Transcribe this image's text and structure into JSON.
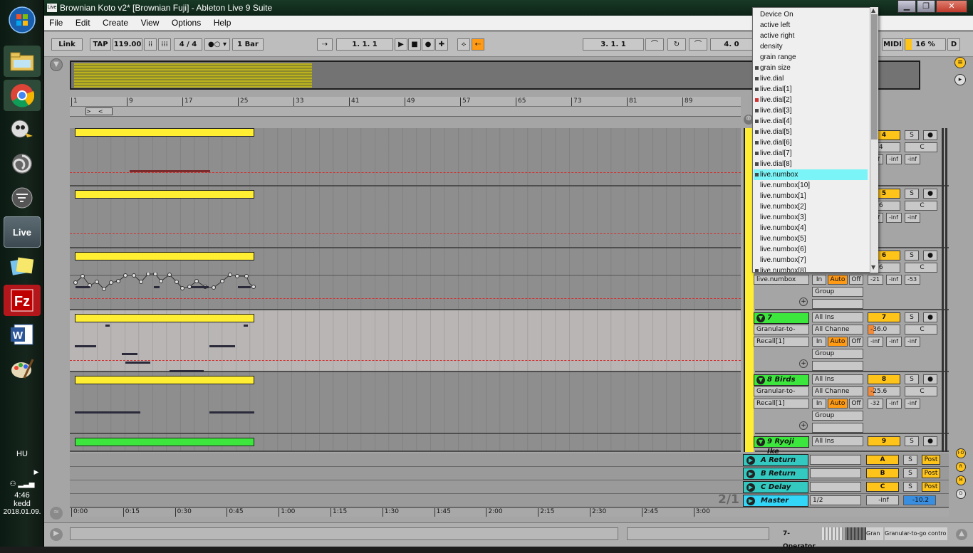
{
  "taskbar": {
    "items": [
      "start-orb",
      "file-explorer",
      "chrome",
      "pidgin",
      "app-spiral",
      "app-wave",
      "ableton-live",
      "sticky-notes",
      "filezilla",
      "word",
      "paint"
    ],
    "live_label": "Live",
    "lang": "HU",
    "time": "4:46",
    "day": "kedd",
    "date": "2018.01.09."
  },
  "window": {
    "title": "Brownian Koto v2*  [Brownian Fuji] - Ableton Live 9 Suite",
    "icon_label": "Live"
  },
  "menu": [
    "File",
    "Edit",
    "Create",
    "View",
    "Options",
    "Help"
  ],
  "control": {
    "link": "Link",
    "tap": "TAP",
    "tempo": "119.00",
    "signature": "4 / 4",
    "quantize": "1 Bar",
    "position": "1.   1.   1",
    "loop_start": "3.   1.   1",
    "loop_length": "4.   0",
    "midi": "MIDI",
    "cpu": "16 %",
    "d": "D"
  },
  "ruler": [
    "1",
    "9",
    "17",
    "25",
    "33",
    "41",
    "49",
    "57",
    "65",
    "73",
    "81",
    "89"
  ],
  "tracks": [
    {
      "name": "",
      "number": "4",
      "vol": "-6.4",
      "pan": "C",
      "l": "-inf",
      "r": "-inf"
    },
    {
      "name": "",
      "number": "5",
      "vol": "-3.6",
      "pan": "C",
      "l": "-inf",
      "r": "-inf"
    },
    {
      "name": "",
      "number": "6",
      "vol": "-9.6",
      "pan": "C",
      "l": "-21",
      "r": "-inf",
      "r2": "-53",
      "param": "live.numbox",
      "in": "In",
      "auto": "Auto",
      "off": "Off",
      "group": "Group"
    },
    {
      "name": "7 Operator",
      "number": "7",
      "input": "All Ins",
      "device": "Granular-to-",
      "channel": "All Channe",
      "vol": "-36.0",
      "pan": "C",
      "recall": "Recall[1]",
      "in": "In",
      "auto": "Auto",
      "off": "Off",
      "l": "-inf",
      "m": "-inf",
      "r": "-inf",
      "group": "Group"
    },
    {
      "name": "8 Birds",
      "number": "8",
      "input": "All Ins",
      "device": "Granular-to-",
      "channel": "All Channe",
      "vol": "-25.6",
      "pan": "C",
      "recall": "Recall[1]",
      "in": "In",
      "auto": "Auto",
      "off": "Off",
      "l": "-32",
      "m": "-inf",
      "r": "-inf",
      "group": "Group"
    },
    {
      "name": "9 Ryoji Ike",
      "number": "9",
      "input": "All Ins"
    }
  ],
  "returns": [
    {
      "name": "A Return",
      "letter": "A",
      "s": "S",
      "post": "Post"
    },
    {
      "name": "B Return",
      "letter": "B",
      "s": "S",
      "post": "Post"
    },
    {
      "name": "C Delay",
      "letter": "C",
      "s": "S",
      "post": "Post"
    },
    {
      "name": "Master",
      "letter": "1/2",
      "vol": "-inf",
      "pan": "-10.2"
    }
  ],
  "timeline": [
    "0:00",
    "0:15",
    "0:30",
    "0:45",
    "1:00",
    "1:15",
    "1:30",
    "1:45",
    "2:00",
    "2:15",
    "2:30",
    "2:45",
    "3:00"
  ],
  "overview_zoom": "2/1",
  "side_buttons": [
    "I·O",
    "R",
    "M",
    "D"
  ],
  "status": {
    "device": "7-Operator",
    "g1": "Gran",
    "g2": "Granular-to-go contro"
  },
  "dropdown": {
    "items": [
      {
        "label": "Device On",
        "sq": "none"
      },
      {
        "label": "active left",
        "sq": "none"
      },
      {
        "label": "active right",
        "sq": "none"
      },
      {
        "label": "density",
        "sq": "none"
      },
      {
        "label": "grain range",
        "sq": "none"
      },
      {
        "label": "grain size",
        "sq": "grey"
      },
      {
        "label": "live.dial",
        "sq": "grey"
      },
      {
        "label": "live.dial[1]",
        "sq": "grey"
      },
      {
        "label": "live.dial[2]",
        "sq": "red"
      },
      {
        "label": "live.dial[3]",
        "sq": "grey"
      },
      {
        "label": "live.dial[4]",
        "sq": "grey"
      },
      {
        "label": "live.dial[5]",
        "sq": "grey"
      },
      {
        "label": "live.dial[6]",
        "sq": "grey"
      },
      {
        "label": "live.dial[7]",
        "sq": "grey"
      },
      {
        "label": "live.dial[8]",
        "sq": "grey"
      },
      {
        "label": "live.numbox",
        "sq": "grey",
        "highlight": true
      },
      {
        "label": "live.numbox[10]",
        "sq": "none"
      },
      {
        "label": "live.numbox[1]",
        "sq": "none"
      },
      {
        "label": "live.numbox[2]",
        "sq": "none"
      },
      {
        "label": "live.numbox[3]",
        "sq": "none"
      },
      {
        "label": "live.numbox[4]",
        "sq": "none"
      },
      {
        "label": "live.numbox[5]",
        "sq": "none"
      },
      {
        "label": "live.numbox[6]",
        "sq": "none"
      },
      {
        "label": "live.numbox[7]",
        "sq": "none"
      },
      {
        "label": "live.numbox[8]",
        "sq": "grey"
      }
    ]
  },
  "colors": {
    "clip": "#ffee32",
    "track_head": "#3de63d",
    "return_head": "#33c9c1",
    "master_head": "#33d6f6",
    "accent": "#ff9a14",
    "highlight": "#7af4f6"
  }
}
